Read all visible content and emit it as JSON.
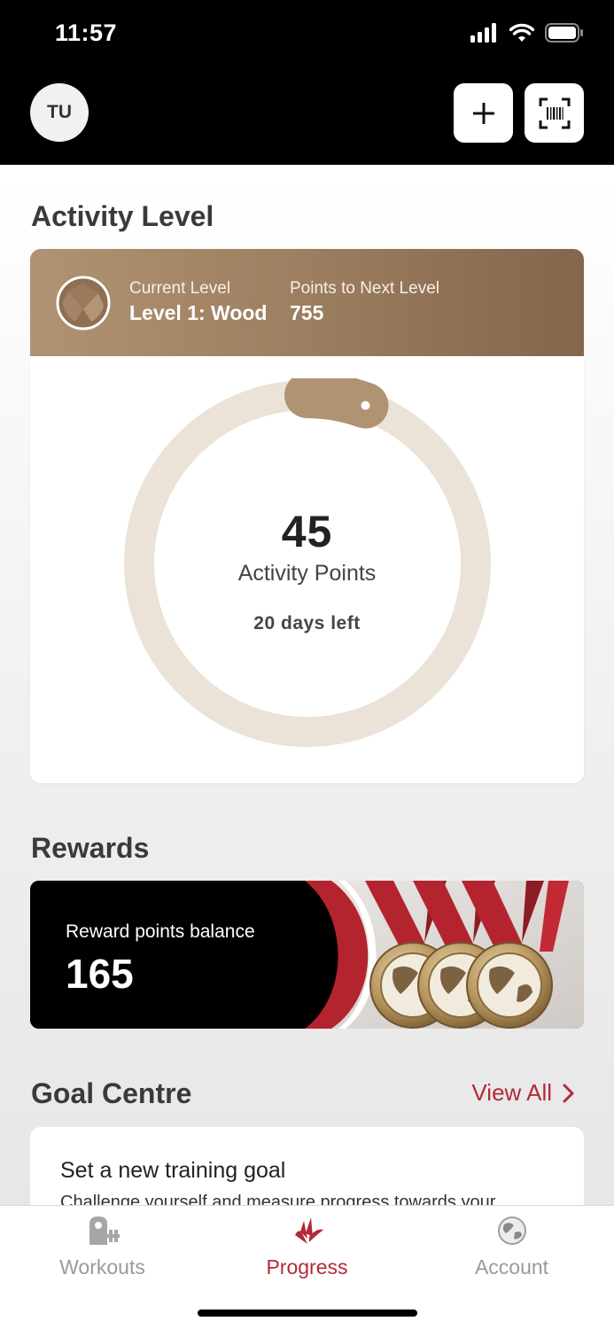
{
  "status_bar": {
    "time": "11:57"
  },
  "header": {
    "avatar_initials": "TU"
  },
  "activity": {
    "section_title": "Activity Level",
    "current_level_label": "Current Level",
    "current_level_value": "Level 1: Wood",
    "next_level_label": "Points to Next Level",
    "next_level_value": "755",
    "points": "45",
    "points_label": "Activity Points",
    "days_left": "20 days left",
    "progress_fraction": 0.056
  },
  "rewards": {
    "section_title": "Rewards",
    "balance_label": "Reward points balance",
    "balance_value": "165"
  },
  "goals": {
    "section_title": "Goal Centre",
    "view_all": "View All",
    "card_title": "Set a new training goal",
    "card_desc": "Challenge yourself and measure progress towards your"
  },
  "tabs": [
    {
      "label": "Workouts",
      "icon": "dumbbell-icon",
      "active": false
    },
    {
      "label": "Progress",
      "icon": "progress-icon",
      "active": true
    },
    {
      "label": "Account",
      "icon": "globe-icon",
      "active": false
    }
  ],
  "colors": {
    "accent": "#b12a37",
    "wood": "#a8896a",
    "ring_track": "#ebe2d8"
  }
}
